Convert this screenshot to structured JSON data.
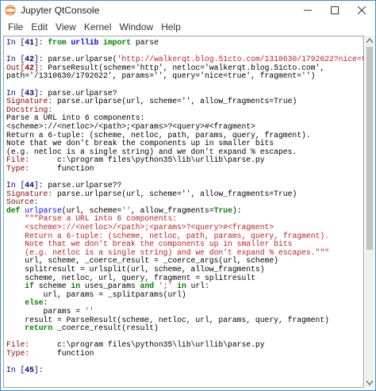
{
  "window": {
    "title": "Jupyter QtConsole"
  },
  "menu": [
    "File",
    "Edit",
    "View",
    "Kernel",
    "Window",
    "Help"
  ],
  "colors": {
    "prompt_in": "#000080",
    "prompt_out": "#8b0000",
    "keyword": "#008000",
    "string": "#ba2121",
    "header": "#8b0000",
    "function": "#0000ff"
  },
  "console": {
    "lines": [
      [
        {
          "t": "In [",
          "c": "in-prompt"
        },
        {
          "t": "41",
          "c": "in-num"
        },
        {
          "t": "]: ",
          "c": "in-prompt"
        },
        {
          "t": "from",
          "c": "kw"
        },
        {
          "t": " "
        },
        {
          "t": "urllib",
          "c": "mod"
        },
        {
          "t": " "
        },
        {
          "t": "import",
          "c": "kw"
        },
        {
          "t": " parse"
        }
      ],
      [],
      [
        {
          "t": "In [",
          "c": "in-prompt"
        },
        {
          "t": "42",
          "c": "in-num"
        },
        {
          "t": "]: ",
          "c": "in-prompt"
        },
        {
          "t": "parse.urlparse("
        },
        {
          "t": "'http://walkerqt.blog.51cto.com/1310630/1792622?nice=true'",
          "c": "str"
        },
        {
          "t": ")"
        }
      ],
      [
        {
          "t": "Out[",
          "c": "out-prompt"
        },
        {
          "t": "42",
          "c": "out-num"
        },
        {
          "t": "]: ",
          "c": "out-prompt"
        },
        {
          "t": "ParseResult(scheme='http', netloc='walkerqt.blog.51cto.com',"
        }
      ],
      [
        {
          "t": "path='/1310630/1792622', params='', query='nice=true', fragment='')"
        }
      ],
      [],
      [
        {
          "t": "In [",
          "c": "in-prompt"
        },
        {
          "t": "43",
          "c": "in-num"
        },
        {
          "t": "]: ",
          "c": "in-prompt"
        },
        {
          "t": "parse.urlparse?"
        }
      ],
      [
        {
          "t": "Signature:",
          "c": "hdr"
        },
        {
          "t": " parse.urlparse(url, scheme='', allow_fragments=True)"
        }
      ],
      [
        {
          "t": "Docstring:",
          "c": "hdr"
        }
      ],
      [
        {
          "t": "Parse a URL into 6 components:"
        }
      ],
      [
        {
          "t": "<scheme>://<netloc>/<path>;<params>?<query>#<fragment>"
        }
      ],
      [
        {
          "t": "Return a 6-tuple: (scheme, netloc, path, params, query, fragment)."
        }
      ],
      [
        {
          "t": "Note that we don't break the components up in smaller bits"
        }
      ],
      [
        {
          "t": "(e.g. netloc is a single string) and we don't expand % escapes."
        }
      ],
      [
        {
          "t": "File:",
          "c": "hdr"
        },
        {
          "t": "      c:\\program files\\python35\\lib\\urllib\\parse.py"
        }
      ],
      [
        {
          "t": "Type:",
          "c": "hdr"
        },
        {
          "t": "      function"
        }
      ],
      [],
      [
        {
          "t": "In [",
          "c": "in-prompt"
        },
        {
          "t": "44",
          "c": "in-num"
        },
        {
          "t": "]: ",
          "c": "in-prompt"
        },
        {
          "t": "parse.urlparse??"
        }
      ],
      [
        {
          "t": "Signature:",
          "c": "hdr"
        },
        {
          "t": " parse.urlparse(url, scheme='', allow_fragments=True)"
        }
      ],
      [
        {
          "t": "Source:",
          "c": "hdr"
        }
      ],
      [
        {
          "t": "def",
          "c": "kw"
        },
        {
          "t": " "
        },
        {
          "t": "urlparse",
          "c": "fn"
        },
        {
          "t": "(url, scheme="
        },
        {
          "t": "''",
          "c": "str"
        },
        {
          "t": ", allow_fragments="
        },
        {
          "t": "True",
          "c": "kw"
        },
        {
          "t": "):"
        }
      ],
      [
        {
          "t": "    "
        },
        {
          "t": "\"\"\"Parse a URL into 6 components:",
          "c": "str"
        }
      ],
      [
        {
          "t": "    "
        },
        {
          "t": "<scheme>://<netloc>/<path>;<params>?<query>#<fragment>",
          "c": "str"
        }
      ],
      [
        {
          "t": "    "
        },
        {
          "t": "Return a 6-tuple: (scheme, netloc, path, params, query, fragment).",
          "c": "str"
        }
      ],
      [
        {
          "t": "    "
        },
        {
          "t": "Note that we don't break the components up in smaller bits",
          "c": "str"
        }
      ],
      [
        {
          "t": "    "
        },
        {
          "t": "(e.g. netloc is a single string) and we don't expand % escapes.\"\"\"",
          "c": "str"
        }
      ],
      [
        {
          "t": "    url, scheme, _coerce_result = _coerce_args(url, scheme)"
        }
      ],
      [
        {
          "t": "    splitresult = urlsplit(url, scheme, allow_fragments)"
        }
      ],
      [
        {
          "t": "    scheme, netloc, url, query, fragment = splitresult"
        }
      ],
      [
        {
          "t": "    "
        },
        {
          "t": "if",
          "c": "kw"
        },
        {
          "t": " scheme "
        },
        {
          "t": "in",
          "c": "kw"
        },
        {
          "t": " uses_params "
        },
        {
          "t": "and",
          "c": "kw"
        },
        {
          "t": " "
        },
        {
          "t": "';'",
          "c": "str"
        },
        {
          "t": " "
        },
        {
          "t": "in",
          "c": "kw"
        },
        {
          "t": " url:"
        }
      ],
      [
        {
          "t": "        url, params = _splitparams(url)"
        }
      ],
      [
        {
          "t": "    "
        },
        {
          "t": "else",
          "c": "kw"
        },
        {
          "t": ":"
        }
      ],
      [
        {
          "t": "        params = "
        },
        {
          "t": "''",
          "c": "str"
        }
      ],
      [
        {
          "t": "    result = ParseResult(scheme, netloc, url, params, query, fragment)"
        }
      ],
      [
        {
          "t": "    "
        },
        {
          "t": "return",
          "c": "kw"
        },
        {
          "t": " _coerce_result(result)"
        }
      ],
      [],
      [
        {
          "t": "File:",
          "c": "hdr"
        },
        {
          "t": "      c:\\program files\\python35\\lib\\urllib\\parse.py"
        }
      ],
      [
        {
          "t": "Type:",
          "c": "hdr"
        },
        {
          "t": "      function"
        }
      ],
      [],
      [
        {
          "t": "In [",
          "c": "in-prompt"
        },
        {
          "t": "45",
          "c": "in-num"
        },
        {
          "t": "]: ",
          "c": "in-prompt"
        }
      ]
    ]
  }
}
